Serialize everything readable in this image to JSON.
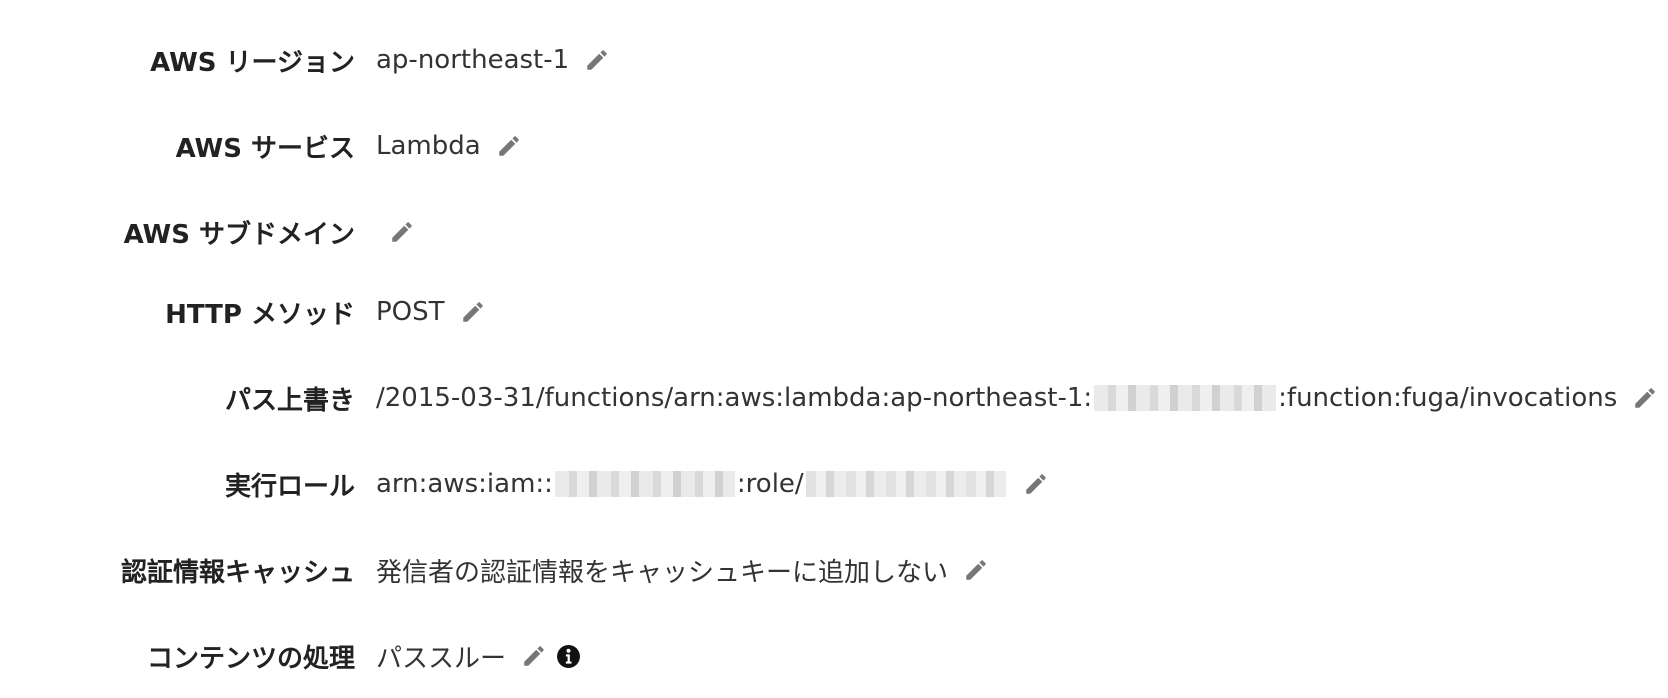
{
  "settings": {
    "rows": [
      {
        "label": "AWS リージョン",
        "value": "ap-northeast-1"
      },
      {
        "label": "AWS サービス",
        "value": "Lambda"
      },
      {
        "label": "AWS サブドメイン",
        "value": ""
      },
      {
        "label": "HTTP メソッド",
        "value": "POST"
      },
      {
        "label": "パス上書き",
        "value_prefix": "/2015-03-31/functions/arn:aws:lambda:ap-northeast-1:",
        "value_suffix": ":function:fuga/invocations"
      },
      {
        "label": "実行ロール",
        "value_prefix": "arn:aws:iam::",
        "value_middle": ":role/"
      },
      {
        "label": "認証情報キャッシュ",
        "value": "発信者の認証情報をキャッシュキーに追加しない"
      },
      {
        "label": "コンテンツの処理",
        "value": "パススルー"
      }
    ]
  },
  "icons": {
    "edit": "pencil-icon",
    "info": "info-circle-icon"
  },
  "colors": {
    "label_text": "#222222",
    "value_text": "#333333",
    "icon_gray": "#777777",
    "info_black": "#111111"
  }
}
